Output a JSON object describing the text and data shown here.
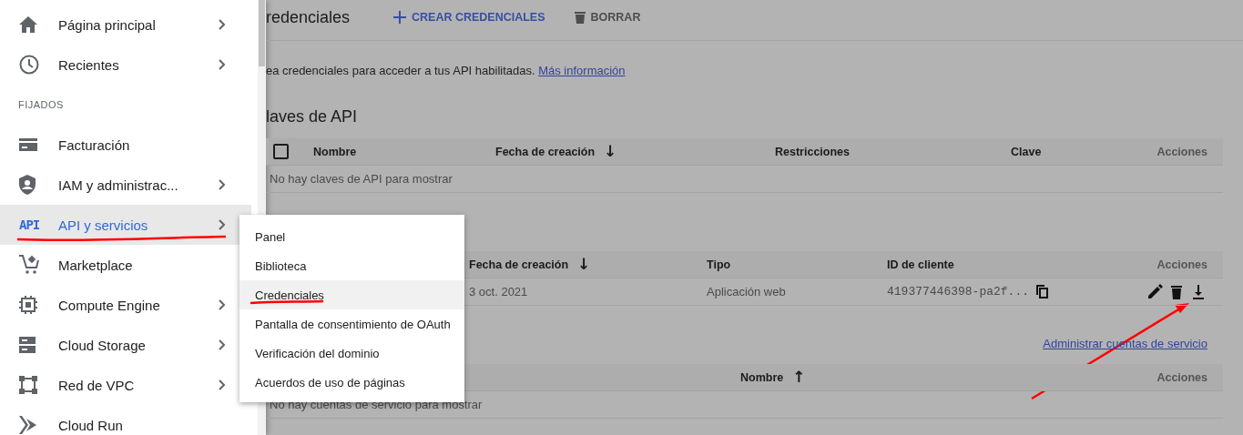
{
  "sidebar": {
    "items": [
      {
        "kind": "link",
        "label": "Página principal",
        "expandable": true,
        "selected": false
      },
      {
        "kind": "link",
        "label": "Recientes",
        "expandable": true,
        "selected": false
      },
      {
        "kind": "section",
        "label": "FIJADOS"
      },
      {
        "kind": "link",
        "label": "Facturación",
        "expandable": false,
        "selected": false
      },
      {
        "kind": "link",
        "label": "IAM y administrac...",
        "expandable": true,
        "selected": false
      },
      {
        "kind": "link",
        "label": "API y servicios",
        "icon_text": "API",
        "expandable": true,
        "selected": true
      },
      {
        "kind": "link",
        "label": "Marketplace",
        "expandable": false,
        "selected": false
      },
      {
        "kind": "link",
        "label": "Compute Engine",
        "expandable": true,
        "selected": false
      },
      {
        "kind": "link",
        "label": "Cloud Storage",
        "expandable": true,
        "selected": false
      },
      {
        "kind": "link",
        "label": "Red de VPC",
        "expandable": true,
        "selected": false
      },
      {
        "kind": "link",
        "label": "Cloud Run",
        "expandable": false,
        "selected": false
      }
    ]
  },
  "submenu": {
    "items": [
      {
        "label": "Panel",
        "selected": false
      },
      {
        "label": "Biblioteca",
        "selected": false
      },
      {
        "label": "Credenciales",
        "selected": true
      },
      {
        "label": "Pantalla de consentimiento de OAuth",
        "selected": false
      },
      {
        "label": "Verificación del dominio",
        "selected": false
      },
      {
        "label": "Acuerdos de uso de páginas",
        "selected": false
      }
    ]
  },
  "toolbar": {
    "title": "redenciales",
    "actions": [
      {
        "kind": "create",
        "label": "CREAR CREDENCIALES"
      },
      {
        "kind": "delete",
        "label": "BORRAR"
      }
    ]
  },
  "description": {
    "text": "ea credenciales para acceder a tus API habilitadas.",
    "link": "Más información"
  },
  "api_keys": {
    "title": "laves de API",
    "select_all_checked": false,
    "columns": [
      {
        "label": "Nombre"
      },
      {
        "label": "Fecha de creación",
        "sort_arrow": "↓"
      },
      {
        "label": "Restricciones"
      },
      {
        "label": "Clave"
      },
      {
        "label": "Acciones"
      }
    ],
    "empty_text": "No hay claves de API para mostrar"
  },
  "oauth_clients": {
    "columns": [
      {
        "label": "Fecha de creación",
        "sort_arrow": "↓"
      },
      {
        "label": "Tipo"
      },
      {
        "label": "ID de cliente"
      },
      {
        "label": "Acciones"
      }
    ],
    "rows": [
      {
        "created": "3 oct. 2021",
        "type": "Aplicación web",
        "client_id": "419377446398-pa2f..."
      }
    ]
  },
  "service_accounts": {
    "manage_link": "Administrar cuentas de servicio",
    "columns": [
      {
        "label": "Nombre",
        "sort_arrow": "↑"
      },
      {
        "label": "Acciones"
      }
    ],
    "empty_text": "No hay cuentas de servicio para mostrar"
  }
}
